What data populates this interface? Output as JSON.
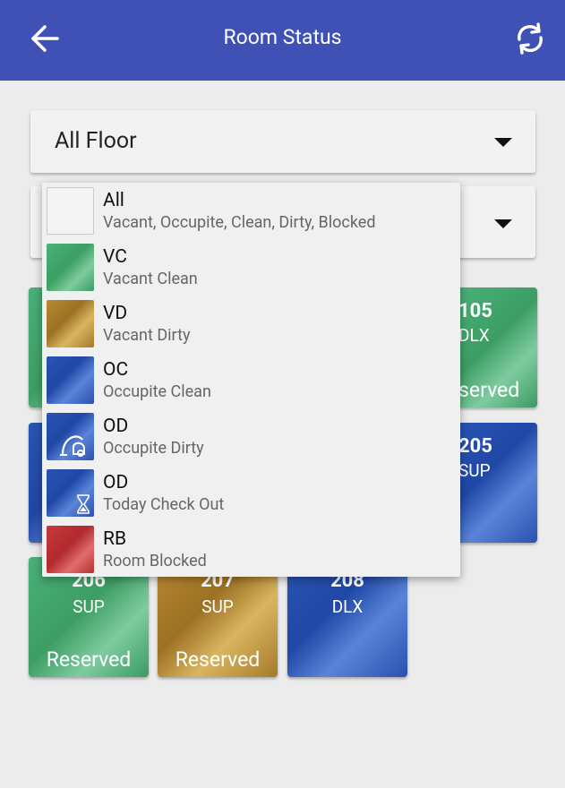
{
  "header": {
    "title": "Room Status",
    "back_icon": "arrow-left-icon",
    "refresh_icon": "sync-icon",
    "color": "#3f51b5"
  },
  "floor_select": {
    "value": "All Floor"
  },
  "status_select": {
    "value": ""
  },
  "status_options": [
    {
      "code": "All",
      "desc": "Vacant, Occupite, Clean, Dirty, Blocked",
      "swatch": "blank"
    },
    {
      "code": "VC",
      "desc": "Vacant Clean",
      "swatch": "green"
    },
    {
      "code": "VD",
      "desc": "Vacant Dirty",
      "swatch": "gold"
    },
    {
      "code": "OC",
      "desc": "Occupite Clean",
      "swatch": "blue"
    },
    {
      "code": "OD",
      "desc": "Occupite Dirty",
      "swatch": "blue",
      "icon": "vacuum-icon"
    },
    {
      "code": "OD",
      "desc": "Today Check Out",
      "swatch": "blue",
      "icon": "hourglass-icon"
    },
    {
      "code": "RB",
      "desc": "Room Blocked",
      "swatch": "red"
    }
  ],
  "rooms": [
    {
      "number": "105",
      "type": "DLX",
      "footer": "served",
      "color": "green"
    },
    {
      "number": "205",
      "type": "SUP",
      "footer": "",
      "color": "blue"
    },
    {
      "number": "206",
      "type": "SUP",
      "footer": "Reserved",
      "color": "green"
    },
    {
      "number": "207",
      "type": "SUP",
      "footer": "Reserved",
      "color": "gold"
    },
    {
      "number": "208",
      "type": "DLX",
      "footer": "",
      "color": "blue"
    }
  ],
  "colors": {
    "green": "#3c9e63",
    "gold": "#a57a2a",
    "blue": "#2a50ae",
    "red": "#b8302f"
  }
}
